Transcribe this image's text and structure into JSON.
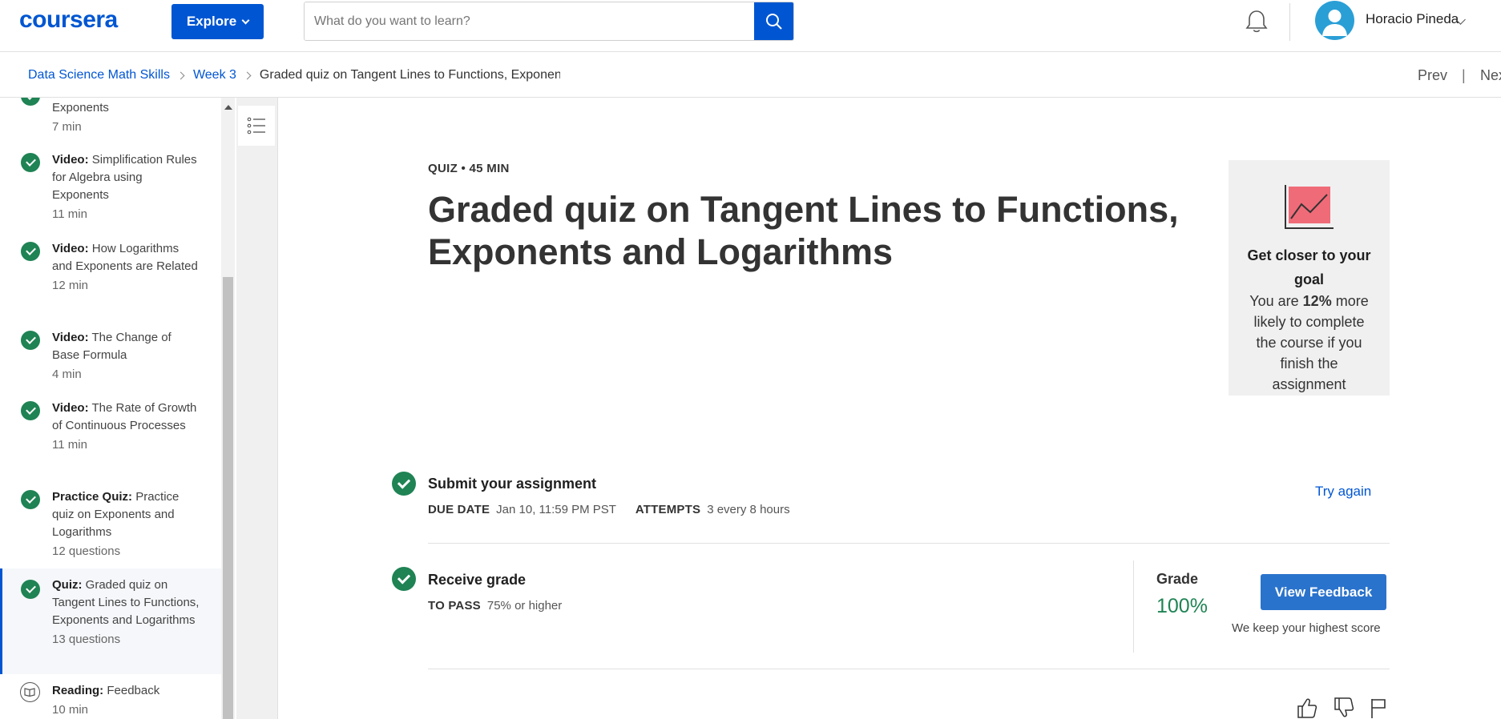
{
  "header": {
    "logo": "coursera",
    "explore_label": "Explore",
    "search": {
      "placeholder": "What do you want to learn?",
      "value": ""
    },
    "user_name": "Horacio Pineda"
  },
  "breadcrumb": {
    "items": [
      "Data Science Math Skills",
      "Week 3"
    ],
    "current": "Graded quiz on Tangent Lines to Functions, Exponents and Logarithms",
    "prev": "Prev",
    "separator": "|",
    "next": "Next"
  },
  "sidebar": {
    "items": [
      {
        "type": "",
        "title": "Exponents",
        "meta": "7 min",
        "icon": "check-icon"
      },
      {
        "type": "Video:",
        "title": "Simplification Rules for Algebra using Exponents",
        "meta": "11 min",
        "icon": "check-icon"
      },
      {
        "type": "Video:",
        "title": "How Logarithms and Exponents are Related",
        "meta": "12 min",
        "icon": "check-icon"
      },
      {
        "type": "Video:",
        "title": "The Change of Base Formula",
        "meta": "4 min",
        "icon": "check-icon"
      },
      {
        "type": "Video:",
        "title": "The Rate of Growth of Continuous Processes",
        "meta": "11 min",
        "icon": "check-icon"
      },
      {
        "type": "Practice Quiz:",
        "title": "Practice quiz on Exponents and Logarithms",
        "meta": "12 questions",
        "icon": "check-icon"
      },
      {
        "type": "Quiz:",
        "title": "Graded quiz on Tangent Lines to Functions, Exponents and Logarithms",
        "meta": "13 questions",
        "icon": "check-icon",
        "active": true
      },
      {
        "type": "Reading:",
        "title": "Feedback",
        "meta": "10 min",
        "icon": "book-icon"
      }
    ]
  },
  "main": {
    "kicker": "QUIZ • 45 MIN",
    "title": "Graded quiz on Tangent Lines to Functions, Exponents and Logarithms",
    "goal_card": {
      "title": "Get closer to your goal",
      "body_prefix": "You are ",
      "percent": "12%",
      "body_suffix": " more likely to complete the course if you finish the assignment"
    },
    "submit": {
      "title": "Submit your assignment",
      "due_label": "DUE DATE",
      "due_value": "Jan 10, 11:59 PM PST",
      "attempts_label": "ATTEMPTS",
      "attempts_value": "3 every 8 hours",
      "action": "Try again"
    },
    "grade": {
      "title": "Receive grade",
      "pass_label": "TO PASS",
      "pass_value": "75% or higher",
      "grade_label": "Grade",
      "grade_value": "100%",
      "button": "View Feedback",
      "note": "We keep your highest score"
    }
  },
  "colors": {
    "brand": "#0056d2",
    "success": "#1f8354",
    "goal_chart": "#f06b78"
  }
}
